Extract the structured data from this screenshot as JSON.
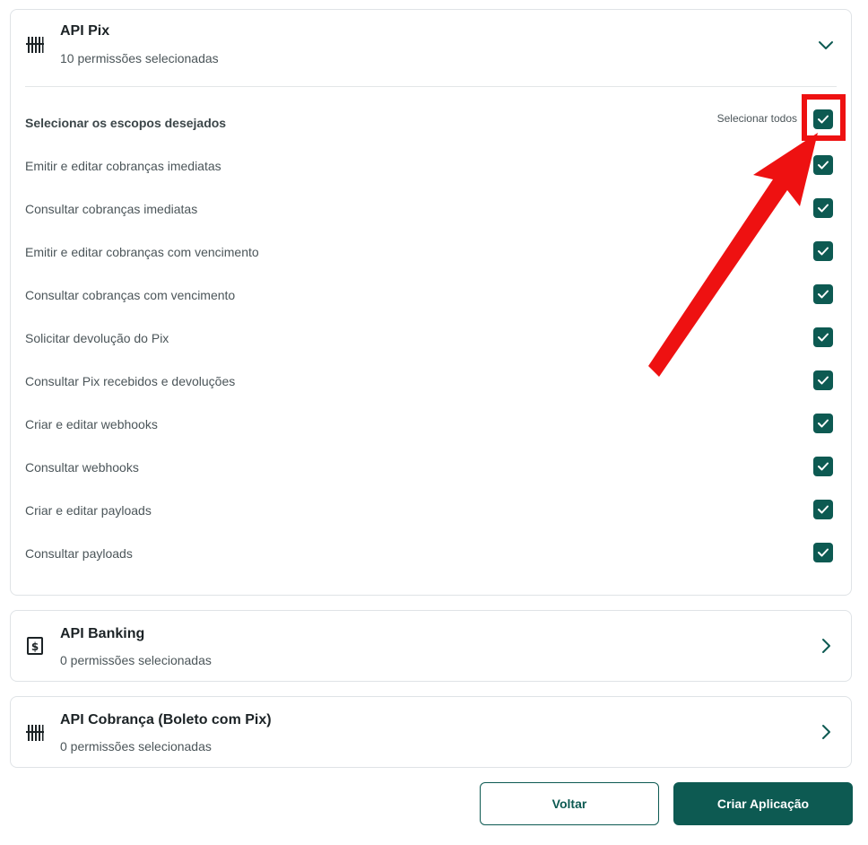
{
  "cards": [
    {
      "title": "API Pix",
      "subtitle": "10 permissões selecionadas",
      "icon": "barcode-icon",
      "expanded": true,
      "scope_heading": "Selecionar os escopos desejados",
      "select_all_label": "Selecionar todos",
      "select_all_checked": true,
      "scopes": [
        {
          "label": "Emitir e editar cobranças imediatas",
          "checked": true
        },
        {
          "label": "Consultar cobranças imediatas",
          "checked": true
        },
        {
          "label": "Emitir e editar cobranças com vencimento",
          "checked": true
        },
        {
          "label": "Consultar cobranças com vencimento",
          "checked": true
        },
        {
          "label": "Solicitar devolução do Pix",
          "checked": true
        },
        {
          "label": "Consultar Pix recebidos e devoluções",
          "checked": true
        },
        {
          "label": "Criar e editar webhooks",
          "checked": true
        },
        {
          "label": "Consultar webhooks",
          "checked": true
        },
        {
          "label": "Criar e editar payloads",
          "checked": true
        },
        {
          "label": "Consultar payloads",
          "checked": true
        }
      ]
    },
    {
      "title": "API Banking",
      "subtitle": "0 permissões selecionadas",
      "icon": "banking-receipt-icon",
      "expanded": false
    },
    {
      "title": "API Cobrança (Boleto com Pix)",
      "subtitle": "0 permissões selecionadas",
      "icon": "barcode-icon",
      "expanded": false
    }
  ],
  "actions": {
    "back_label": "Voltar",
    "create_label": "Criar Aplicação"
  },
  "colors": {
    "accent": "#0d5a52",
    "annotation": "#ee1111"
  }
}
